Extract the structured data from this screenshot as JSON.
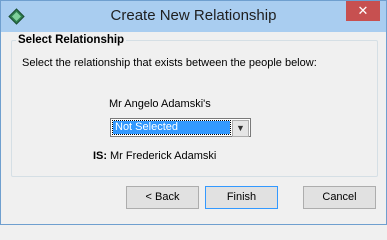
{
  "window": {
    "title": "Create New Relationship",
    "close_glyph": "✕"
  },
  "group": {
    "title": "Select Relationship",
    "instruction": "Select the relationship that exists between the people below:",
    "person1": "Mr Angelo Adamski's",
    "relationship_selected": "Not Selected",
    "is_label": "IS:",
    "person2": "Mr Frederick Adamski"
  },
  "buttons": {
    "back": "< Back",
    "finish": "Finish",
    "cancel": "Cancel"
  },
  "icons": {
    "app": "app-icon",
    "close": "close-icon",
    "dropdown": "chevron-down-icon"
  },
  "colors": {
    "titlebar": "#a9cdf0",
    "close": "#c75050",
    "selection": "#3399ff"
  }
}
